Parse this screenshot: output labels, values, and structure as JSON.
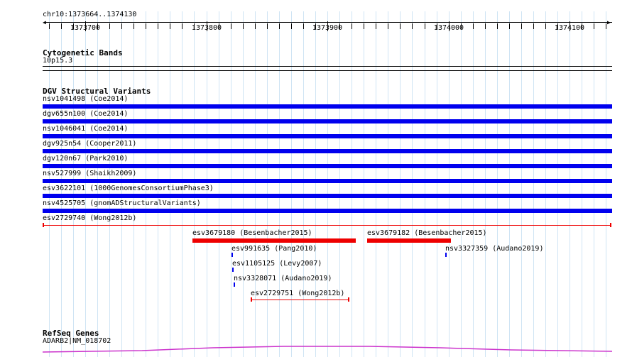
{
  "region": {
    "label": "chr10:1373664..1374130"
  },
  "ruler": {
    "ticks": [
      {
        "label": "1373700",
        "pos": 1373700
      },
      {
        "label": "1373800",
        "pos": 1373800
      },
      {
        "label": "1373900",
        "pos": 1373900
      },
      {
        "label": "1374000",
        "pos": 1374000
      },
      {
        "label": "1374100",
        "pos": 1374100
      }
    ]
  },
  "tracks": {
    "cytoband": {
      "title": "Cytogenetic Bands",
      "band": "10p15.3"
    },
    "dgv": {
      "title": "DGV Structural Variants",
      "features": [
        {
          "id": "nsv1041498",
          "study": "Coe2014",
          "label": "nsv1041498 (Coe2014)",
          "color": "#0000ee",
          "style": "bar"
        },
        {
          "id": "dgv655n100",
          "study": "Coe2014",
          "label": "dgv655n100 (Coe2014)",
          "color": "#0000ee",
          "style": "bar"
        },
        {
          "id": "nsv1046041",
          "study": "Coe2014",
          "label": "nsv1046041 (Coe2014)",
          "color": "#0000ee",
          "style": "bar"
        },
        {
          "id": "dgv925n54",
          "study": "Cooper2011",
          "label": "dgv925n54 (Cooper2011)",
          "color": "#0000ee",
          "style": "bar"
        },
        {
          "id": "dgv120n67",
          "study": "Park2010",
          "label": "dgv120n67 (Park2010)",
          "color": "#0000ee",
          "style": "bar"
        },
        {
          "id": "nsv527999",
          "study": "Shaikh2009",
          "label": "nsv527999 (Shaikh2009)",
          "color": "#0000ee",
          "style": "bar"
        },
        {
          "id": "esv3622101",
          "study": "1000GenomesConsortiumPhase3",
          "label": "esv3622101 (1000GenomesConsortiumPhase3)",
          "color": "#0000ee",
          "style": "bar"
        },
        {
          "id": "nsv4525705",
          "study": "gnomADStructuralVariants",
          "label": "nsv4525705 (gnomADStructuralVariants)",
          "color": "#0000ee",
          "style": "bar"
        },
        {
          "id": "esv2729740",
          "study": "Wong2012b",
          "label": "esv2729740 (Wong2012b)",
          "color": "#ee0000",
          "style": "line"
        },
        {
          "id": "esv3679180",
          "study": "Besenbacher2015",
          "label": "esv3679180 (Besenbacher2015)",
          "color": "#ee0000",
          "style": "bar"
        },
        {
          "id": "esv3679182",
          "study": "Besenbacher2015",
          "label": "esv3679182 (Besenbacher2015)",
          "color": "#ee0000",
          "style": "bar"
        },
        {
          "id": "esv991635",
          "study": "Pang2010",
          "label": "esv991635 (Pang2010)",
          "color": "#0000ee",
          "style": "mark"
        },
        {
          "id": "nsv3327359",
          "study": "Audano2019",
          "label": "nsv3327359 (Audano2019)",
          "color": "#0000ee",
          "style": "mark"
        },
        {
          "id": "esv1105125",
          "study": "Levy2007",
          "label": "esv1105125 (Levy2007)",
          "color": "#0000ee",
          "style": "mark"
        },
        {
          "id": "nsv3328071",
          "study": "Audano2019",
          "label": "nsv3328071 (Audano2019)",
          "color": "#0000ee",
          "style": "mark"
        },
        {
          "id": "esv2729751",
          "study": "Wong2012b",
          "label": "esv2729751 (Wong2012b)",
          "color": "#ee0000",
          "style": "line"
        }
      ]
    },
    "refseq": {
      "title": "RefSeq Genes",
      "gene": "ADARB2|NM_018702",
      "color": "#cc33cc"
    }
  },
  "colors": {
    "grid": "#cfe4f4",
    "dgv_gain_loss": "#0000ee",
    "dgv_loss": "#ee0000"
  }
}
